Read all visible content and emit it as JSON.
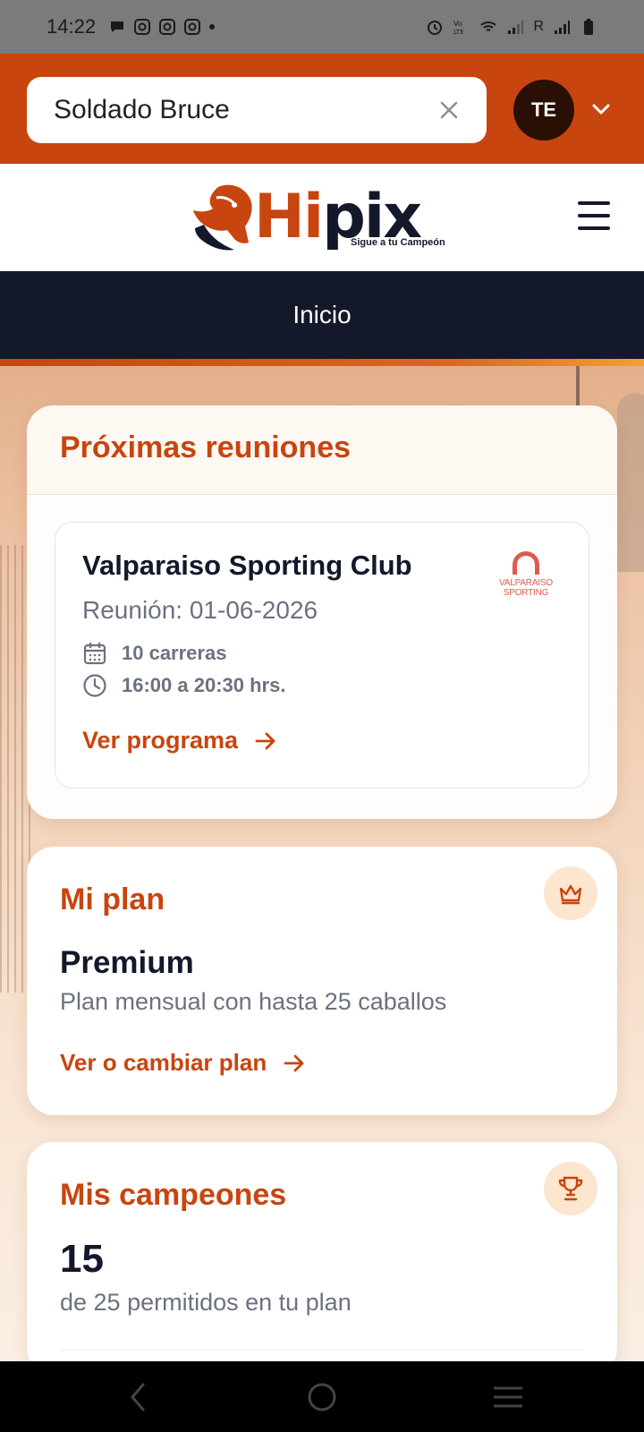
{
  "status_bar": {
    "time": "14:22",
    "carrier_r": "R"
  },
  "search": {
    "value": "Soldado Bruce"
  },
  "user": {
    "initials": "TE"
  },
  "brand": {
    "name_hi": "Hi",
    "name_pix": "pix",
    "tagline": "Sigue a tu Campeón"
  },
  "nav": {
    "current": "Inicio"
  },
  "upcoming": {
    "title": "Próximas reuniones",
    "meeting": {
      "club": "Valparaiso Sporting Club",
      "date": "Reunión: 01-06-2026",
      "races": "10 carreras",
      "hours": "16:00 a 20:30 hrs.",
      "link": "Ver programa",
      "logo_line1": "VALPARAISO",
      "logo_line2": "SPORTING"
    }
  },
  "plan": {
    "title": "Mi plan",
    "name": "Premium",
    "description": "Plan mensual con hasta 25 caballos",
    "link": "Ver o cambiar plan",
    "icon": "crown-icon"
  },
  "champions": {
    "title": "Mis campeones",
    "count": "15",
    "description": "de 25 permitidos en tu plan",
    "icon": "trophy-icon"
  },
  "colors": {
    "accent": "#c8450f",
    "navy": "#13192a",
    "muted": "#6c7180"
  }
}
